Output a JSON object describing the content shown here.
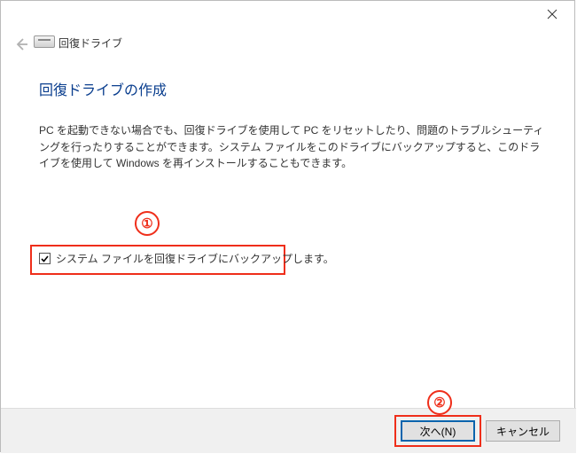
{
  "window": {
    "header_title": "回復ドライブ"
  },
  "page": {
    "title": "回復ドライブの作成",
    "description": "PC を起動できない場合でも、回復ドライブを使用して PC をリセットしたり、問題のトラブルシューティングを行ったりすることができます。システム ファイルをこのドライブにバックアップすると、このドライブを使用して Windows を再インストールすることもできます。"
  },
  "checkbox": {
    "label": "システム ファイルを回復ドライブにバックアップします。",
    "checked": true
  },
  "buttons": {
    "next": "次へ(N)",
    "cancel": "キャンセル"
  },
  "annotations": {
    "one": "①",
    "two": "②"
  }
}
